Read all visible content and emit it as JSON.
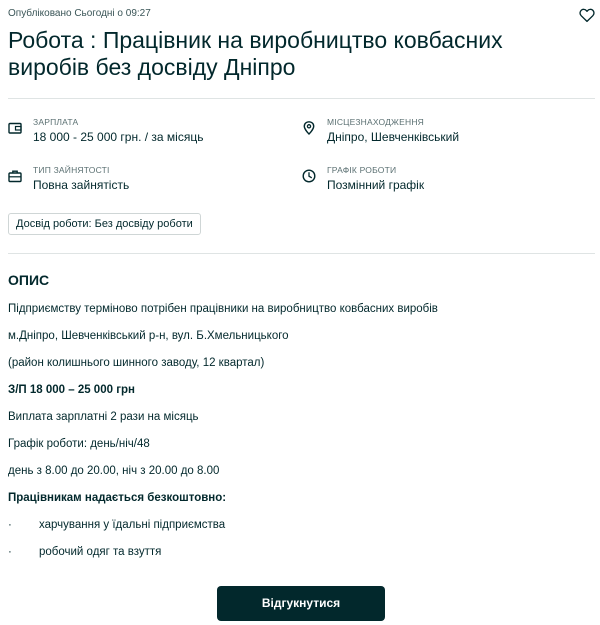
{
  "header": {
    "published": "Опубліковано Сьогодні о 09:27",
    "favorite_icon": "heart-outline-icon",
    "title": "Робота : Працівник на виробництво ковбасних виробів без досвіду Дніпро"
  },
  "details": {
    "salary": {
      "label": "ЗАРПЛАТА",
      "value": "18 000 - 25 000 грн. / за місяць",
      "icon": "wallet-icon"
    },
    "location": {
      "label": "МІСЦЕЗНАХОДЖЕННЯ",
      "value": "Дніпро, Шевченківський",
      "icon": "location-pin-icon"
    },
    "employment": {
      "label": "ТИП ЗАЙНЯТОСТІ",
      "value": "Повна зайнятість",
      "icon": "briefcase-icon"
    },
    "schedule": {
      "label": "ГРАФІК РОБОТИ",
      "value": "Позмінний графік",
      "icon": "clock-icon"
    },
    "experience_tag": "Досвід роботи: Без досвіду роботи"
  },
  "description": {
    "heading": "ОПИС",
    "lines": [
      "Підприємству терміново потрібен працівники на виробництво ковбасних виробів",
      "м.Дніпро,  Шевченківський р-н, вул. Б.Хмельницького",
      "(район  колишнього шинного заводу, 12 квартал)",
      "З/П  18 000 – 25 000 грн",
      "Виплата зарплатні 2 рази на місяць",
      "Графік роботи: день/ніч/48",
      "день з 8.00 до 20.00,  ніч з 20.00 до 8.00",
      "Працівникам надається безкоштовно:"
    ],
    "bullet_marker": "·",
    "bullets": [
      "харчування у їдальні підприємства",
      "робочий одяг та взуття"
    ]
  },
  "actions": {
    "apply_label": "Відгукнутися"
  }
}
